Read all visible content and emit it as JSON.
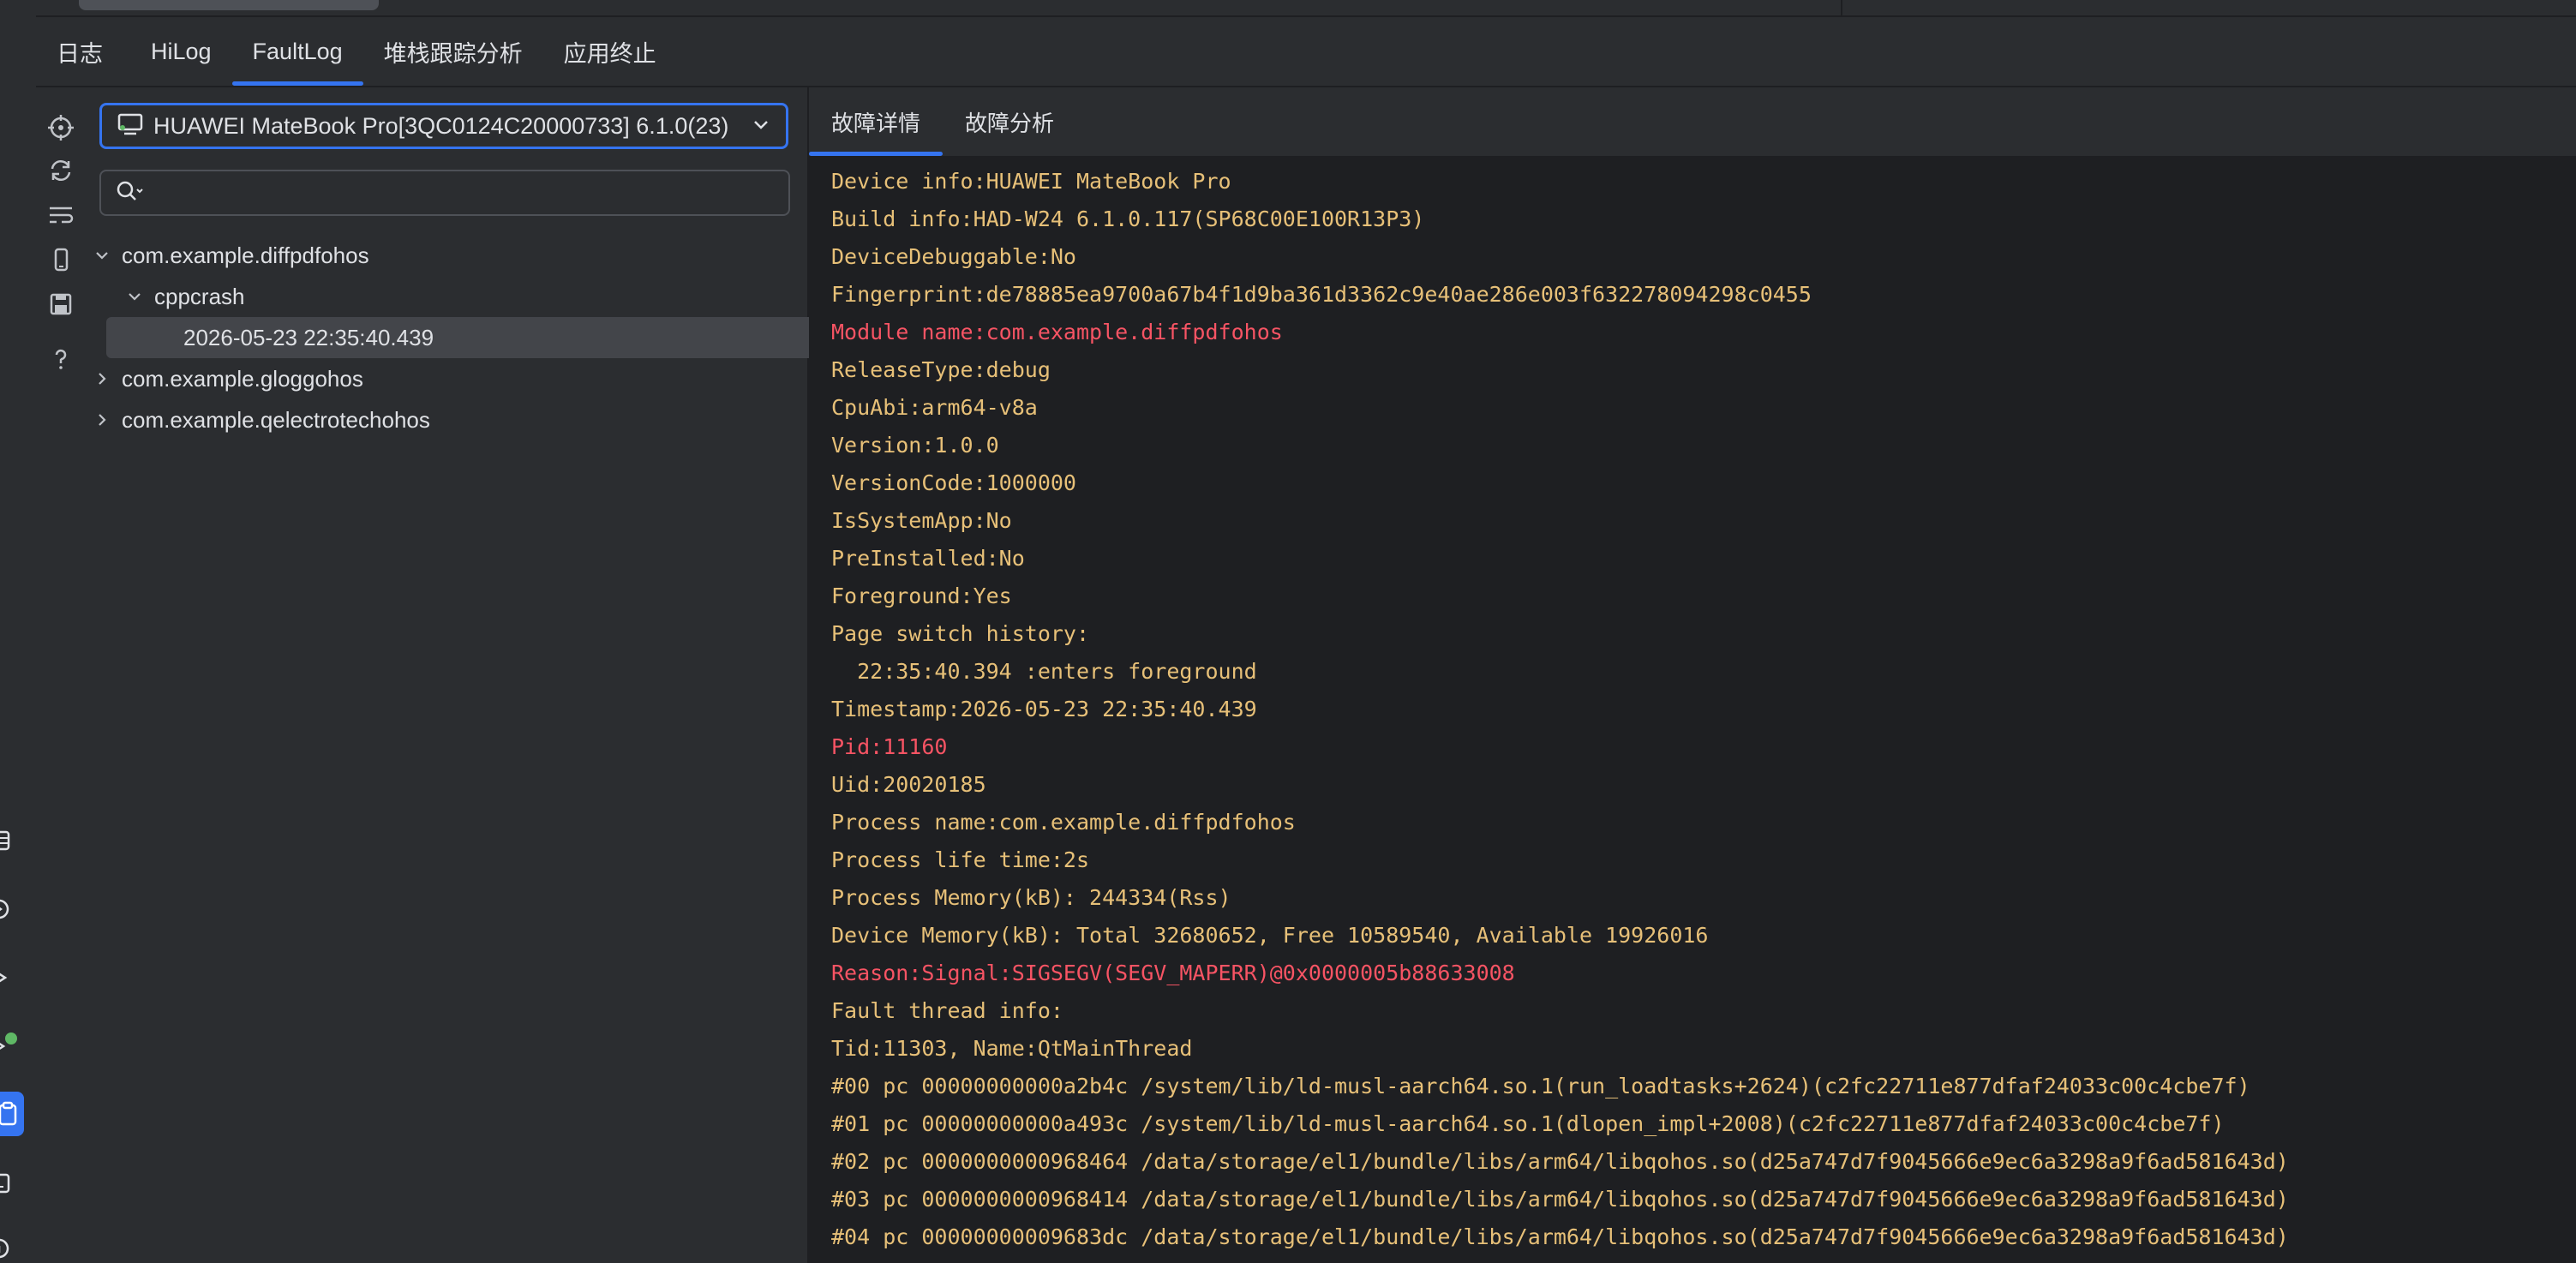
{
  "header": {
    "tabs": [
      {
        "label": "日志",
        "active": false
      },
      {
        "label": "HiLog",
        "active": false
      },
      {
        "label": "FaultLog",
        "active": true
      },
      {
        "label": "堆栈跟踪分析",
        "active": false
      },
      {
        "label": "应用终止",
        "active": false
      }
    ]
  },
  "left_panel": {
    "device_select": {
      "value": "HUAWEI MateBook Pro[3QC0124C20000733] 6.1.0(23)"
    },
    "search": {
      "value": "",
      "placeholder": ""
    },
    "tree": [
      {
        "label": "com.example.diffpdfohos",
        "expanded": true
      },
      {
        "label": "cppcrash",
        "expanded": true
      },
      {
        "label": "2026-05-23 22:35:40.439",
        "selected": true
      },
      {
        "label": "com.example.gloggohos",
        "expanded": false
      },
      {
        "label": "com.example.qelectrotechohos",
        "expanded": false
      }
    ]
  },
  "right_panel": {
    "tabs": [
      {
        "label": "故障详情",
        "active": true
      },
      {
        "label": "故障分析",
        "active": false
      }
    ],
    "log_lines": [
      {
        "text": "Device info:HUAWEI MateBook Pro",
        "color": "#e7c078"
      },
      {
        "text": "Build info:HAD-W24 6.1.0.117(SP68C00E100R13P3)",
        "color": "#e7c078"
      },
      {
        "text": "DeviceDebuggable:No",
        "color": "#e7c078"
      },
      {
        "text": "Fingerprint:de78885ea9700a67b4f1d9ba361d3362c9e40ae286e003f632278094298c0455",
        "color": "#e7c078"
      },
      {
        "text": "Module name:com.example.diffpdfohos",
        "color": "#f75464"
      },
      {
        "text": "ReleaseType:debug",
        "color": "#e7c078"
      },
      {
        "text": "CpuAbi:arm64-v8a",
        "color": "#e7c078"
      },
      {
        "text": "Version:1.0.0",
        "color": "#e7c078"
      },
      {
        "text": "VersionCode:1000000",
        "color": "#e7c078"
      },
      {
        "text": "IsSystemApp:No",
        "color": "#e7c078"
      },
      {
        "text": "PreInstalled:No",
        "color": "#e7c078"
      },
      {
        "text": "Foreground:Yes",
        "color": "#e7c078"
      },
      {
        "text": "Page switch history:",
        "color": "#e7c078"
      },
      {
        "text": "  22:35:40.394 :enters foreground",
        "color": "#e7c078"
      },
      {
        "text": "Timestamp:2026-05-23 22:35:40.439",
        "color": "#e7c078"
      },
      {
        "text": "Pid:11160",
        "color": "#f75464"
      },
      {
        "text": "Uid:20020185",
        "color": "#e7c078"
      },
      {
        "text": "Process name:com.example.diffpdfohos",
        "color": "#e7c078"
      },
      {
        "text": "Process life time:2s",
        "color": "#e7c078"
      },
      {
        "text": "Process Memory(kB): 244334(Rss)",
        "color": "#e7c078"
      },
      {
        "text": "Device Memory(kB): Total 32680652, Free 10589540, Available 19926016",
        "color": "#e7c078"
      },
      {
        "text": "Reason:Signal:SIGSEGV(SEGV_MAPERR)@0x0000005b88633008",
        "color": "#f75464"
      },
      {
        "text": "Fault thread info:",
        "color": "#e7c078"
      },
      {
        "text": "Tid:11303, Name:QtMainThread",
        "color": "#e7c078"
      },
      {
        "text": "#00 pc 00000000000a2b4c /system/lib/ld-musl-aarch64.so.1(run_loadtasks+2624)(c2fc22711e877dfaf24033c00c4cbe7f)",
        "color": "#e7c078"
      },
      {
        "text": "#01 pc 00000000000a493c /system/lib/ld-musl-aarch64.so.1(dlopen_impl+2008)(c2fc22711e877dfaf24033c00c4cbe7f)",
        "color": "#e7c078"
      },
      {
        "text": "#02 pc 0000000000968464 /data/storage/el1/bundle/libs/arm64/libqohos.so(d25a747d7f9045666e9ec6a3298a9f6ad581643d)",
        "color": "#e7c078"
      },
      {
        "text": "#03 pc 0000000000968414 /data/storage/el1/bundle/libs/arm64/libqohos.so(d25a747d7f9045666e9ec6a3298a9f6ad581643d)",
        "color": "#e7c078"
      },
      {
        "text": "#04 pc 00000000009683dc /data/storage/el1/bundle/libs/arm64/libqohos.so(d25a747d7f9045666e9ec6a3298a9f6ad581643d)",
        "color": "#e7c078"
      }
    ]
  },
  "colors": {
    "accent": "#3574f0",
    "log_text": "#e7c078",
    "log_error": "#f75464",
    "panel_bg": "#2b2d30",
    "log_bg": "#1e1f22"
  },
  "icons": {
    "tools": [
      "crosshair-icon",
      "refresh-icon",
      "wrap-icon",
      "phone-icon",
      "save-icon",
      "help-icon"
    ],
    "left_strip": [
      "list-icon",
      "play-icon",
      "run-icon",
      "debug-icon",
      "clipboard-icon",
      "terminal-icon",
      "info-icon"
    ]
  }
}
